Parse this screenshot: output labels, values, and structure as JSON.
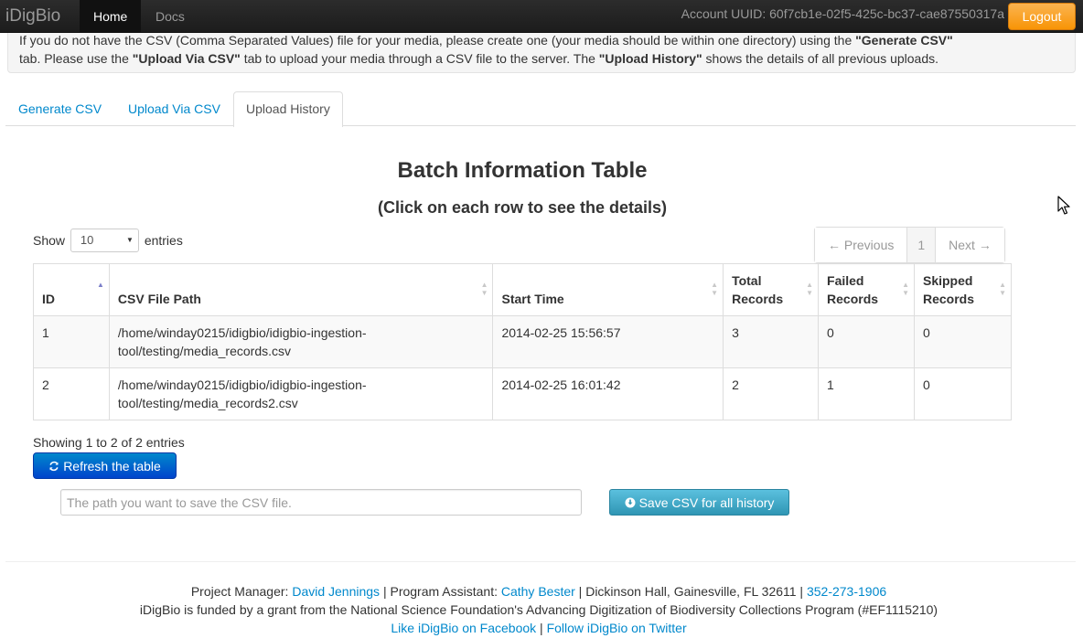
{
  "navbar": {
    "brand": "iDigBio",
    "items": [
      {
        "label": "Home"
      },
      {
        "label": "Docs"
      }
    ],
    "account_text": "Account UUID: 60f7cb1e-02f5-425c-bc37-cae87550317a",
    "logout_label": "Logout"
  },
  "info": {
    "line1_a": "If you do not have the CSV (Comma Separated Values) file for your media, please create one (your media should be within one directory) using the ",
    "line1_b": "\"Generate CSV\"",
    "line1_c": " tab. Please use the ",
    "line1_d": "\"Upload Via CSV\"",
    "line1_e": " tab to upload your media through a CSV file to the server. The ",
    "line1_f": "\"Upload History\"",
    "line1_g": " shows the details of all previous uploads."
  },
  "tabs": [
    {
      "label": "Generate CSV"
    },
    {
      "label": "Upload Via CSV"
    },
    {
      "label": "Upload History"
    }
  ],
  "batch": {
    "title": "Batch Information Table",
    "subtitle": "(Click on each row to see the details)",
    "show_label": "Show",
    "page_size": "10",
    "entries_label": "entries",
    "pagination": {
      "prev": "← Previous",
      "current": "1",
      "next": "Next →"
    },
    "columns": {
      "id": "ID",
      "path": "CSV File Path",
      "start": "Start Time",
      "total_a": "Total",
      "total_b": "Records",
      "failed_a": "Failed",
      "failed_b": "Records",
      "skipped_a": "Skipped",
      "skipped_b": "Records"
    },
    "rows": [
      {
        "id": "1",
        "path_a": "/home/winday0215/idigbio/idigbio-ingestion-",
        "path_b": "tool/testing/media_records.csv",
        "start": "2014-02-25 15:56:57",
        "total": "3",
        "failed": "0",
        "skipped": "0"
      },
      {
        "id": "2",
        "path_a": "/home/winday0215/idigbio/idigbio-ingestion-",
        "path_b": "tool/testing/media_records2.csv",
        "start": "2014-02-25 16:01:42",
        "total": "2",
        "failed": "1",
        "skipped": "0"
      }
    ],
    "count_text": "Showing 1 to 2 of 2 entries",
    "refresh_label": "Refresh the table",
    "save_placeholder": "The path you want to save the CSV file.",
    "save_label": "Save CSV for all history"
  },
  "footer": {
    "pm_label": "Project Manager: ",
    "pm_name": "David Jennings",
    "sep1": " | Program Assistant: ",
    "pa_name": "Cathy Bester",
    "sep2": " | Dickinson Hall, Gainesville, FL 32611 | ",
    "phone": "352-273-1906",
    "funding": "iDigBio is funded by a grant from the National Science Foundation's Advancing Digitization of Biodiversity Collections Program (#EF1115210)",
    "facebook": "Like iDigBio on Facebook",
    "sep3": " | ",
    "twitter": "Follow iDigBio on Twitter"
  },
  "colors": {
    "navbar": "#1c1c1c",
    "link": "#0088cc",
    "logout": "#f89406",
    "refresh": "#0044cc",
    "save": "#2f96b4"
  },
  "icons": {
    "refresh": "refresh-icon",
    "save": "download-circle-icon",
    "sort": "sort-icon",
    "cursor": "mouse-cursor-icon"
  }
}
